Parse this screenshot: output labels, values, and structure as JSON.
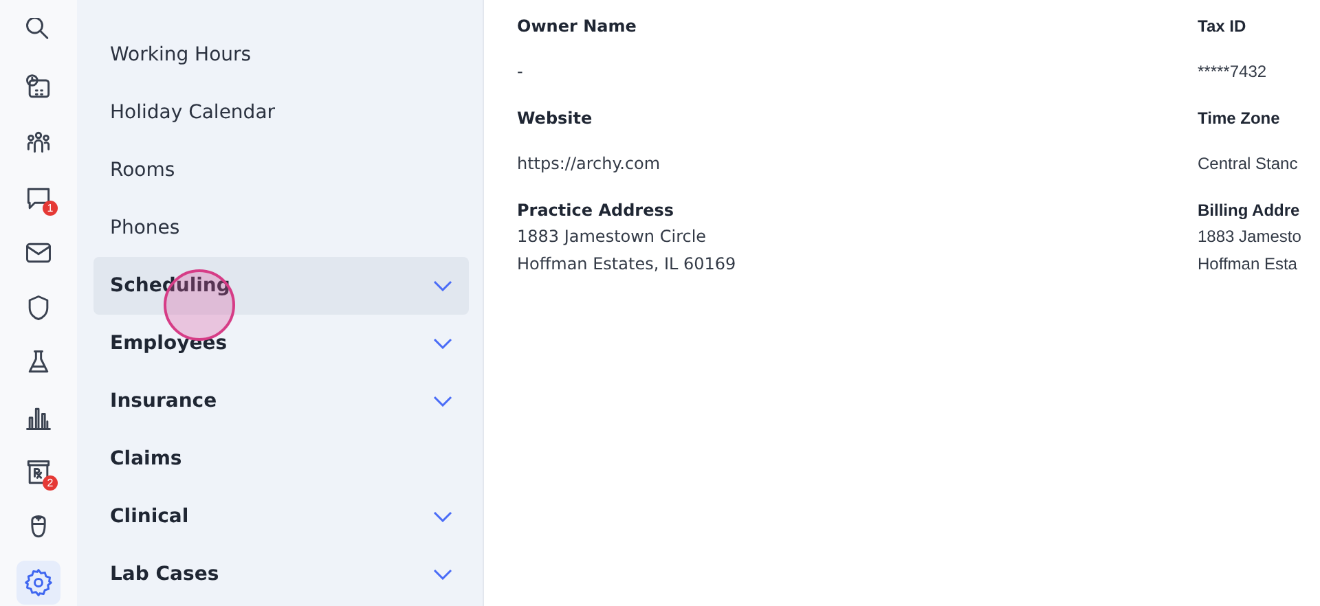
{
  "nav_rail": [
    {
      "selected": false
    },
    {
      "selected": false
    },
    {
      "selected": false
    },
    {
      "badge": "1",
      "selected": false
    },
    {
      "selected": false
    },
    {
      "selected": false
    },
    {
      "selected": false
    },
    {
      "selected": false
    },
    {
      "badge": "2",
      "selected": false
    },
    {
      "selected": false
    },
    {
      "selected": true
    }
  ],
  "settings_menu": [
    {
      "label": "Working Hours",
      "kind": "link",
      "expandable": false,
      "selected": false
    },
    {
      "label": "Holiday Calendar",
      "kind": "link",
      "expandable": false,
      "selected": false
    },
    {
      "label": "Rooms",
      "kind": "link",
      "expandable": false,
      "selected": false
    },
    {
      "label": "Phones",
      "kind": "link",
      "expandable": false,
      "selected": false
    },
    {
      "label": "Scheduling",
      "kind": "section",
      "expandable": true,
      "selected": true
    },
    {
      "label": "Employees",
      "kind": "section",
      "expandable": true,
      "selected": false
    },
    {
      "label": "Insurance",
      "kind": "section",
      "expandable": true,
      "selected": false
    },
    {
      "label": "Claims",
      "kind": "section",
      "expandable": false,
      "selected": false
    },
    {
      "label": "Clinical",
      "kind": "section",
      "expandable": true,
      "selected": false
    },
    {
      "label": "Lab Cases",
      "kind": "section",
      "expandable": true,
      "selected": false
    }
  ],
  "details": [
    {
      "fields": [
        {
          "label": "Owner Name",
          "lines": [
            "-"
          ],
          "kind": "spaced"
        },
        {
          "label": "Website",
          "lines": [
            "https://archy.com"
          ],
          "kind": "spaced"
        },
        {
          "label": "Practice Address",
          "lines": [
            "1883 Jamestown Circle",
            "Hoffman Estates, IL 60169"
          ],
          "kind": "address"
        }
      ]
    },
    {
      "fields": [
        {
          "label": "Tax ID",
          "lines": [
            "*****7432"
          ],
          "kind": "spaced"
        },
        {
          "label": "Time Zone",
          "lines": [
            "Central Stanc"
          ],
          "kind": "spaced"
        },
        {
          "label": "Billing Addre",
          "lines": [
            "1883 Jamesto",
            "Hoffman Esta"
          ],
          "kind": "address"
        }
      ]
    }
  ]
}
